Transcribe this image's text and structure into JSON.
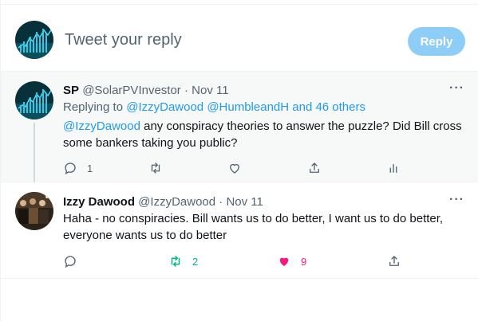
{
  "composer": {
    "placeholder": "Tweet your reply",
    "reply_label": "Reply"
  },
  "tweets": [
    {
      "name": "SP",
      "handle": "@SolarPVInvestor",
      "separator": "·",
      "date": "Nov 11",
      "replying_prefix": "Replying to ",
      "replying_mentions": "@IzzyDawood @HumbleandH and 46 others",
      "mention": "@IzzyDawood",
      "text": " any conspiracy theories to answer the puzzle? Did Bill cross some bankers taking you public?",
      "reply_count": "1",
      "retweet_count": "",
      "like_count": ""
    },
    {
      "name": "Izzy Dawood",
      "handle": "@IzzyDawood",
      "separator": "·",
      "date": "Nov 11",
      "text": "Haha - no conspiracies.  Bill wants us to do better, I want us to do better, everyone wants us to do better",
      "reply_count": "",
      "retweet_count": "2",
      "like_count": "9"
    }
  ],
  "colors": {
    "accent": "#1d9bf0",
    "reply_button_disabled": "#8ecdf8",
    "retweet_active": "#00ba7c",
    "like_active": "#f91880",
    "muted_text": "#536471"
  },
  "icons": [
    "more-icon",
    "reply-icon",
    "retweet-icon",
    "like-icon",
    "share-icon",
    "analytics-icon"
  ]
}
